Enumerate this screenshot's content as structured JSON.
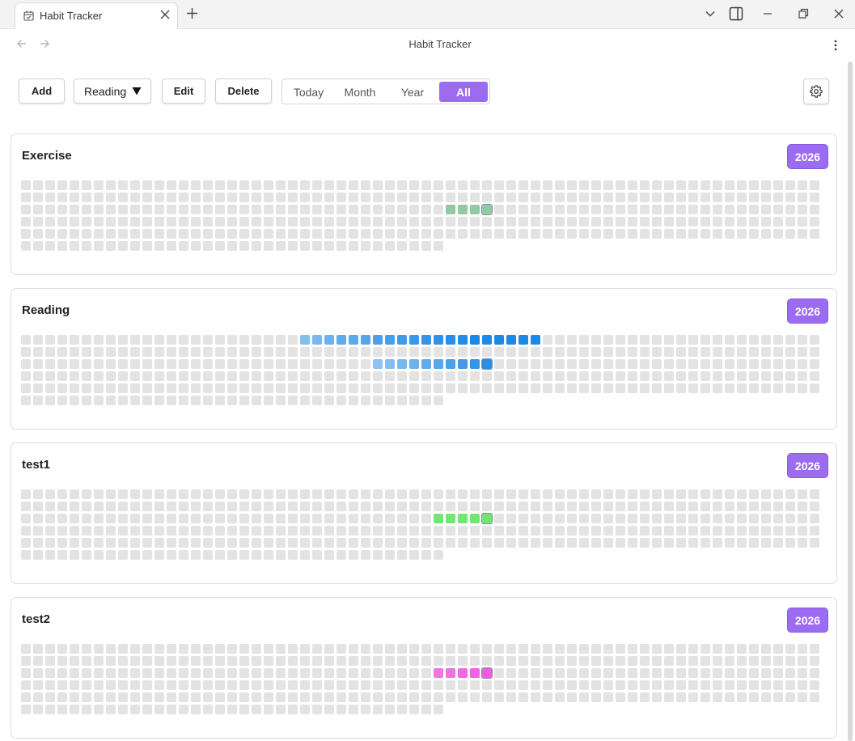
{
  "window": {
    "tab_title": "Habit Tracker",
    "page_title": "Habit Tracker"
  },
  "toolbar": {
    "add_label": "Add",
    "selected_habit": "Reading",
    "edit_label": "Edit",
    "delete_label": "Delete",
    "views": [
      "Today",
      "Month",
      "Year",
      "All"
    ],
    "active_view": "All"
  },
  "colors": {
    "accent": "#9c6cf0",
    "empty_cell": "#e3e3e3"
  },
  "habits": [
    {
      "name": "Exercise",
      "year": "2026",
      "color": "#86c29a",
      "marks": [
        [
          35,
          2,
          0.9
        ],
        [
          36,
          2,
          0.9
        ],
        [
          37,
          2,
          0.9
        ],
        [
          38,
          2,
          0.9
        ]
      ]
    },
    {
      "name": "Reading",
      "year": "2026",
      "color": "#1e88e5",
      "marks": [
        [
          23,
          0,
          0.55
        ],
        [
          24,
          0,
          0.6
        ],
        [
          25,
          0,
          0.65
        ],
        [
          26,
          0,
          0.7
        ],
        [
          27,
          0,
          0.72
        ],
        [
          28,
          0,
          0.75
        ],
        [
          29,
          0,
          0.8
        ],
        [
          30,
          0,
          0.82
        ],
        [
          31,
          0,
          0.85
        ],
        [
          32,
          0,
          0.87
        ],
        [
          33,
          0,
          0.9
        ],
        [
          34,
          0,
          0.92
        ],
        [
          35,
          0,
          0.95
        ],
        [
          36,
          0,
          0.97
        ],
        [
          37,
          0,
          1
        ],
        [
          38,
          0,
          1
        ],
        [
          39,
          0,
          1
        ],
        [
          40,
          0,
          1
        ],
        [
          41,
          0,
          1
        ],
        [
          42,
          0,
          1
        ],
        [
          29,
          2,
          0.5
        ],
        [
          30,
          2,
          0.55
        ],
        [
          31,
          2,
          0.6
        ],
        [
          32,
          2,
          0.65
        ],
        [
          33,
          2,
          0.7
        ],
        [
          34,
          2,
          0.75
        ],
        [
          35,
          2,
          0.8
        ],
        [
          36,
          2,
          0.85
        ],
        [
          37,
          2,
          0.9
        ],
        [
          38,
          2,
          0.95
        ]
      ]
    },
    {
      "name": "test1",
      "year": "2026",
      "color": "#6ee86e",
      "marks": [
        [
          34,
          2,
          1
        ],
        [
          35,
          2,
          1
        ],
        [
          36,
          2,
          1
        ],
        [
          37,
          2,
          1
        ],
        [
          38,
          2,
          1
        ]
      ]
    },
    {
      "name": "test2",
      "year": "2026",
      "color": "#f05ce0",
      "marks": [
        [
          34,
          2,
          0.85
        ],
        [
          35,
          2,
          0.88
        ],
        [
          36,
          2,
          0.92
        ],
        [
          37,
          2,
          0.96
        ],
        [
          38,
          2,
          1
        ]
      ]
    }
  ]
}
